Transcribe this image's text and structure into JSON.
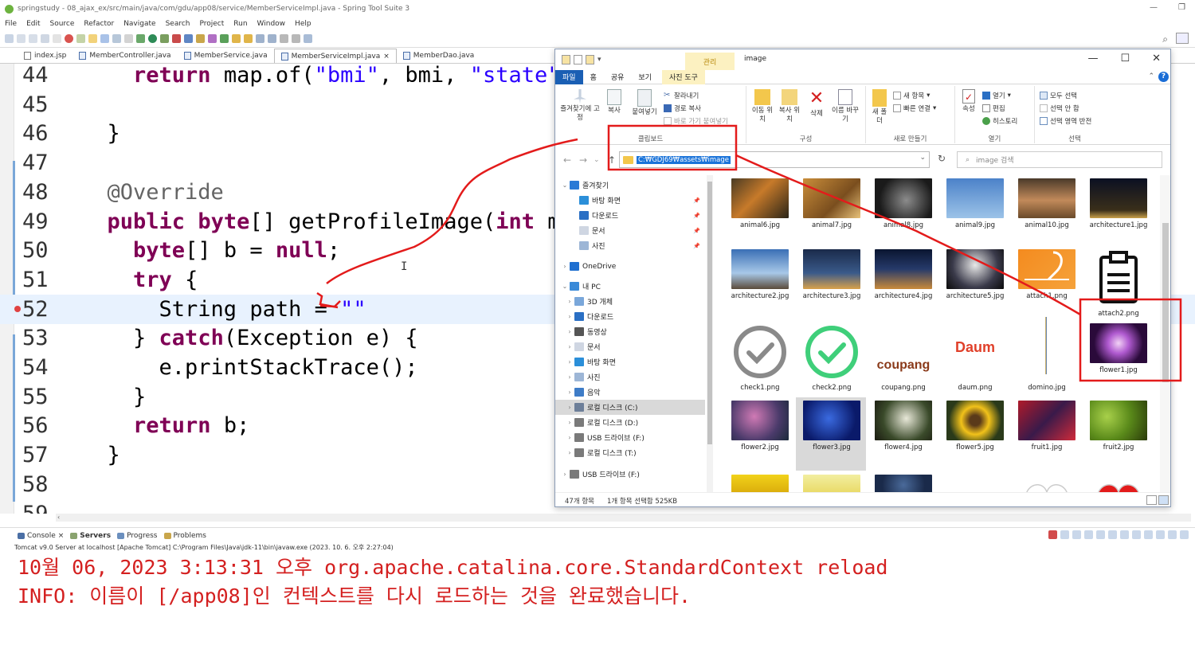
{
  "window": {
    "title": "springstudy - 08_ajax_ex/src/main/java/com/gdu/app08/service/MemberServiceImpl.java - Spring Tool Suite 3",
    "minimize": "—",
    "restore": "❐"
  },
  "menu": [
    "File",
    "Edit",
    "Source",
    "Refactor",
    "Navigate",
    "Search",
    "Project",
    "Run",
    "Window",
    "Help"
  ],
  "editor_tabs": [
    {
      "label": "index.jsp",
      "active": false
    },
    {
      "label": "MemberController.java",
      "active": false
    },
    {
      "label": "MemberService.java",
      "active": false
    },
    {
      "label": "MemberServiceImpl.java",
      "active": true,
      "close": "×"
    },
    {
      "label": "MemberDao.java",
      "active": false
    }
  ],
  "code": {
    "lines": [
      {
        "n": "44",
        "text": "    return map.of(\"bmi\", bmi, \"state\", s"
      },
      {
        "n": "45",
        "text": ""
      },
      {
        "n": "46",
        "text": "  }"
      },
      {
        "n": "47",
        "text": ""
      },
      {
        "n": "48",
        "text": "  @Override"
      },
      {
        "n": "49",
        "text": "  public byte[] getProfileImage(int memb"
      },
      {
        "n": "50",
        "text": "    byte[] b = null;"
      },
      {
        "n": "51",
        "text": "    try {"
      },
      {
        "n": "52",
        "text": "      String path = \"\""
      },
      {
        "n": "53",
        "text": "    } catch(Exception e) {"
      },
      {
        "n": "54",
        "text": "      e.printStackTrace();"
      },
      {
        "n": "55",
        "text": "    }"
      },
      {
        "n": "56",
        "text": "    return b;"
      },
      {
        "n": "57",
        "text": "  }"
      },
      {
        "n": "58",
        "text": ""
      },
      {
        "n": "59",
        "text": ""
      }
    ],
    "cursor_line": "52"
  },
  "bottom_tabs": [
    {
      "label": "Console",
      "close": "×"
    },
    {
      "label": "Servers"
    },
    {
      "label": "Progress"
    },
    {
      "label": "Problems"
    }
  ],
  "server_info": "Tomcat v9.0 Server at localhost [Apache Tomcat] C:\\Program Files\\Java\\jdk-11\\bin\\javaw.exe  (2023. 10. 6. 오후 2:27:04)",
  "console_lines": [
    "10월 06, 2023 3:13:31 오후 org.apache.catalina.core.StandardContext reload",
    "INFO: 이름이 [/app08]인 컨텍스트를 다시 로드하는 것을 완료했습니다."
  ],
  "explorer": {
    "ctx_tab": "관리",
    "title": "image",
    "ribbon_tabs": [
      "파일",
      "홈",
      "공유",
      "보기",
      "사진 도구"
    ],
    "clipboard": {
      "pin": "즐겨찾기에 고정",
      "copy": "복사",
      "paste": "붙여넣기",
      "cut": "잘라내기",
      "copy_path": "경로 복사",
      "paste_shortcut": "바로 가기 붙여넣기",
      "label": "클립보드"
    },
    "organize": {
      "move": "이동 위치",
      "copyto": "복사 위치",
      "delete": "삭제",
      "rename": "이름 바꾸기",
      "label": "구성"
    },
    "new": {
      "new_folder": "새 폴더",
      "new_item": "새 항목",
      "easy_access": "빠른 연결",
      "label": "새로 만들기"
    },
    "open": {
      "props": "속성",
      "open": "열기",
      "edit": "편집",
      "history": "히스토리",
      "label": "열기"
    },
    "select": {
      "all": "모두 선택",
      "none": "선택 안 함",
      "invert": "선택 영역 반전",
      "label": "선택"
    },
    "address": "C:₩GDJ69₩assets₩image",
    "search_placeholder": "image 검색",
    "nav_items": [
      {
        "label": "즐겨찾기",
        "pin": false,
        "chev": "⌄",
        "color": "#2a7ad6"
      },
      {
        "label": "바탕 화면",
        "pin": true,
        "chev": "",
        "color": "#2b8fd9"
      },
      {
        "label": "다운로드",
        "pin": true,
        "chev": "",
        "color": "#2a6fc4"
      },
      {
        "label": "문서",
        "pin": true,
        "chev": "",
        "color": "#cfd6e2"
      },
      {
        "label": "사진",
        "pin": true,
        "chev": "",
        "color": "#9db6d6"
      },
      {
        "label": "OneDrive",
        "pin": false,
        "chev": "›",
        "color": "#1f6fd0"
      },
      {
        "label": "내 PC",
        "pin": false,
        "chev": "⌄",
        "color": "#3a8ad8"
      },
      {
        "label": "3D 개체",
        "pin": false,
        "chev": "›",
        "color": "#7aa7da"
      },
      {
        "label": "다운로드",
        "pin": false,
        "chev": "›",
        "color": "#2a6fc4"
      },
      {
        "label": "동영상",
        "pin": false,
        "chev": "›",
        "color": "#555"
      },
      {
        "label": "문서",
        "pin": false,
        "chev": "›",
        "color": "#cfd6e2"
      },
      {
        "label": "바탕 화면",
        "pin": false,
        "chev": "›",
        "color": "#2b8fd9"
      },
      {
        "label": "사진",
        "pin": false,
        "chev": "›",
        "color": "#9db6d6"
      },
      {
        "label": "음악",
        "pin": false,
        "chev": "›",
        "color": "#3e7cc7"
      },
      {
        "label": "로컬 디스크 (C:)",
        "pin": false,
        "chev": "›",
        "color": "#6d7f99",
        "selected": true
      },
      {
        "label": "로컬 디스크 (D:)",
        "pin": false,
        "chev": "›",
        "color": "#7a7a7a"
      },
      {
        "label": "USB 드라이브 (F:)",
        "pin": false,
        "chev": "›",
        "color": "#7a7a7a"
      },
      {
        "label": "로컬 디스크 (T:)",
        "pin": false,
        "chev": "›",
        "color": "#7a7a7a"
      },
      {
        "label": "USB 드라이브 (F:)",
        "pin": false,
        "chev": "›",
        "color": "#7a7a7a"
      }
    ],
    "files": [
      {
        "name": "animal6.jpg",
        "thumb": "tiger"
      },
      {
        "name": "animal7.jpg",
        "thumb": "giraffe"
      },
      {
        "name": "animal8.jpg",
        "thumb": "lion"
      },
      {
        "name": "animal9.jpg",
        "thumb": "eagle"
      },
      {
        "name": "animal10.jpg",
        "thumb": "lioness"
      },
      {
        "name": "architecture1.jpg",
        "thumb": "night-city"
      },
      {
        "name": "architecture2.jpg",
        "thumb": "eiffel"
      },
      {
        "name": "architecture3.jpg",
        "thumb": "bridge"
      },
      {
        "name": "architecture4.jpg",
        "thumb": "palace"
      },
      {
        "name": "architecture5.jpg",
        "thumb": "fireworks"
      },
      {
        "name": "attach1.png",
        "thumb": "attach-envelope"
      },
      {
        "name": "attach2.png",
        "thumb": "clipboard"
      },
      {
        "name": "check1.png",
        "thumb": "check-gray"
      },
      {
        "name": "check2.png",
        "thumb": "check-green"
      },
      {
        "name": "coupang.png",
        "thumb": "coupang-logo"
      },
      {
        "name": "daum.png",
        "thumb": "daum-logo"
      },
      {
        "name": "domino.jpg",
        "thumb": "domino"
      },
      {
        "name": "flower1.jpg",
        "thumb": "purple-flower"
      },
      {
        "name": "flower2.jpg",
        "thumb": "rose"
      },
      {
        "name": "flower3.jpg",
        "thumb": "blue-rose",
        "selected": true
      },
      {
        "name": "flower4.jpg",
        "thumb": "white-flower"
      },
      {
        "name": "flower5.jpg",
        "thumb": "sunflower"
      },
      {
        "name": "fruit1.jpg",
        "thumb": "berries"
      },
      {
        "name": "fruit2.jpg",
        "thumb": "pears"
      },
      {
        "name": "",
        "thumb": "yellow"
      },
      {
        "name": "",
        "thumb": "lemon"
      },
      {
        "name": "",
        "thumb": "blueberry"
      },
      {
        "name": "",
        "thumb": "blank"
      },
      {
        "name": "",
        "thumb": "white-heart"
      },
      {
        "name": "",
        "thumb": "red-heart"
      }
    ],
    "status_count": "47개 항목",
    "status_selected": "1개 항목 선택함 525KB"
  },
  "coupang_text": "coupang",
  "daum_text": "Daum",
  "colors": {
    "annotation_red": "#e31b1b",
    "address_highlight": "#1a73d9",
    "console_text": "#d42020"
  }
}
